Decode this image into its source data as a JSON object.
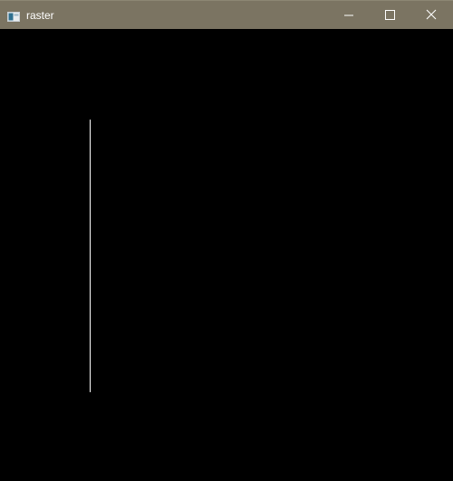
{
  "window": {
    "title": "raster",
    "titlebar_color": "#7b7462",
    "canvas_color": "#000000",
    "line_color": "#ffffff"
  },
  "titlebar": {
    "icon": "app-window-icon",
    "controls": [
      "minimize-icon",
      "maximize-icon",
      "close-icon"
    ]
  }
}
